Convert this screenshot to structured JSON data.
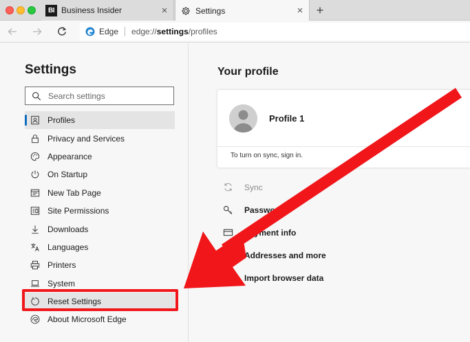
{
  "window": {
    "tabs": [
      {
        "logo_text": "BI",
        "title": "Business Insider",
        "close": "×"
      },
      {
        "title": "Settings",
        "close": "×"
      }
    ],
    "new_tab_label": "+"
  },
  "toolbar": {
    "browser_label": "Edge",
    "url": {
      "scheme": "edge://",
      "host": "settings",
      "path": "/profiles"
    }
  },
  "sidebar": {
    "title": "Settings",
    "search_placeholder": "Search settings",
    "items": [
      {
        "label": "Profiles",
        "icon": "profiles-icon",
        "active": true
      },
      {
        "label": "Privacy and Services",
        "icon": "lock-icon"
      },
      {
        "label": "Appearance",
        "icon": "palette-icon"
      },
      {
        "label": "On Startup",
        "icon": "power-icon"
      },
      {
        "label": "New Tab Page",
        "icon": "new-tab-page-icon"
      },
      {
        "label": "Site Permissions",
        "icon": "site-permissions-icon"
      },
      {
        "label": "Downloads",
        "icon": "download-icon"
      },
      {
        "label": "Languages",
        "icon": "languages-icon"
      },
      {
        "label": "Printers",
        "icon": "printer-icon"
      },
      {
        "label": "System",
        "icon": "laptop-icon"
      },
      {
        "label": "Reset Settings",
        "icon": "reset-icon",
        "highlighted": true
      },
      {
        "label": "About Microsoft Edge",
        "icon": "edge-icon"
      }
    ]
  },
  "main": {
    "heading": "Your profile",
    "profile": {
      "name": "Profile 1",
      "sync_hint": "To turn on sync, sign in."
    },
    "items": [
      {
        "label": "Sync",
        "icon": "sync-icon",
        "disabled": true
      },
      {
        "label": "Passwords",
        "icon": "key-icon"
      },
      {
        "label": "Payment info",
        "icon": "credit-card-icon"
      },
      {
        "label": "Addresses and more",
        "icon": "address-icon"
      },
      {
        "label": "Import browser data",
        "icon": "import-icon"
      }
    ]
  },
  "annotation": {
    "arrow_color": "#f0161a",
    "highlight_color": "#f0161a"
  }
}
